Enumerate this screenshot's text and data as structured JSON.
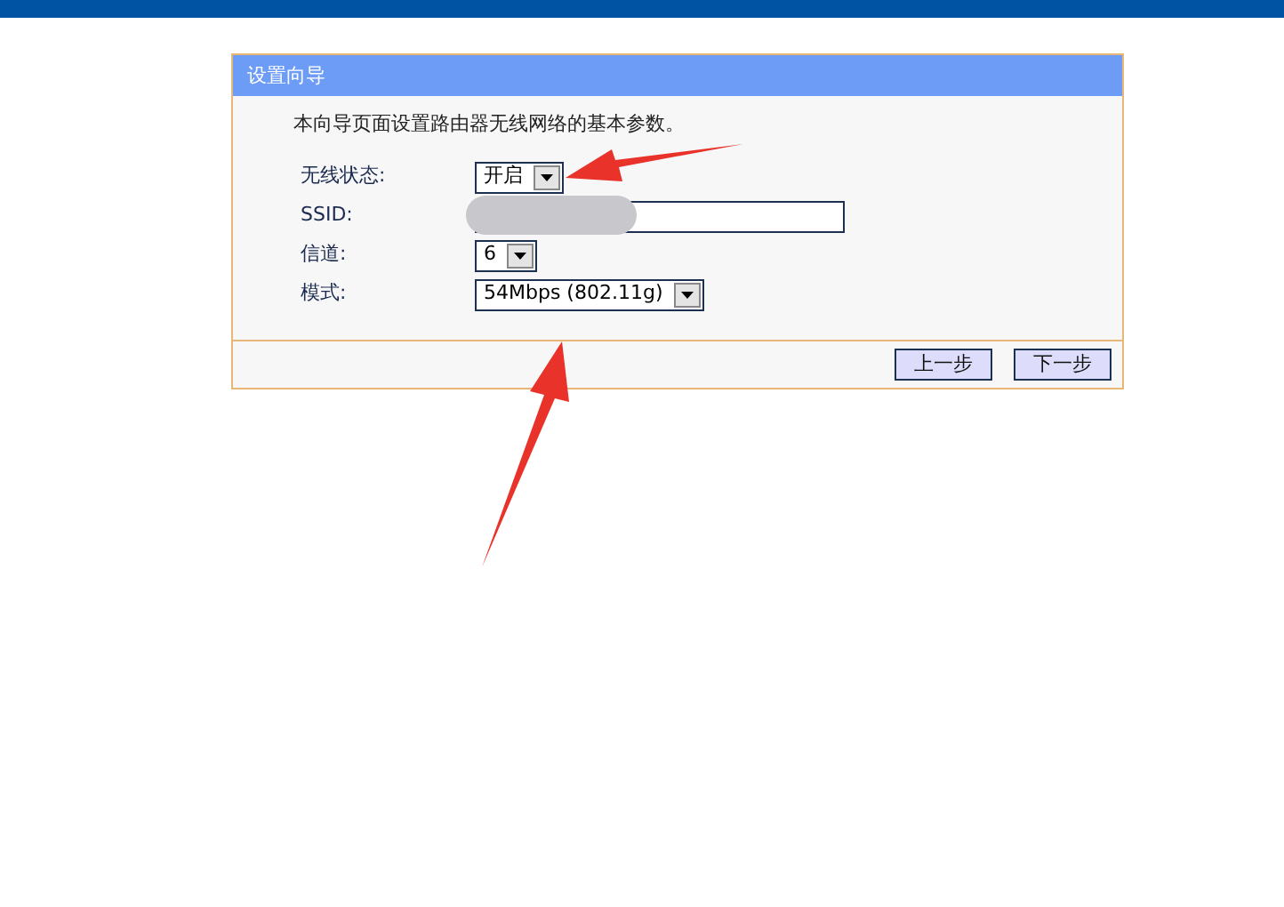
{
  "panel": {
    "title": "设置向导",
    "intro": "本向导页面设置路由器无线网络的基本参数。",
    "fields": [
      {
        "label": "无线状态:",
        "kind": "select",
        "value": "开启"
      },
      {
        "label": "SSID:",
        "kind": "text"
      },
      {
        "label": "信道:",
        "kind": "select",
        "value": "6"
      },
      {
        "label": "模式:",
        "kind": "select",
        "value": "54Mbps (802.11g)"
      }
    ],
    "buttons": [
      "上一步",
      "下一步"
    ]
  }
}
